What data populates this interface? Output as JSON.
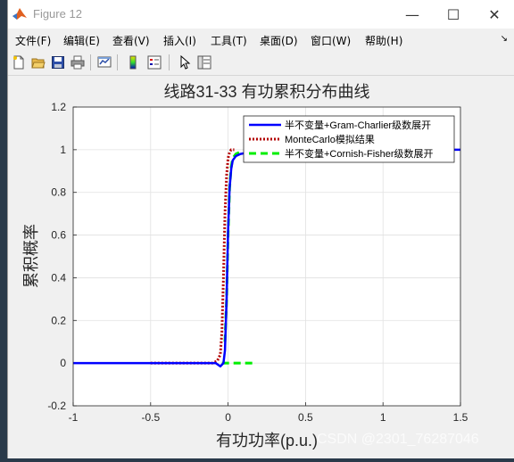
{
  "window": {
    "title": "Figure 12",
    "minimize": "—",
    "maximize": "☐",
    "close": "✕"
  },
  "menu": {
    "items": [
      "文件(F)",
      "编辑(E)",
      "查看(V)",
      "插入(I)",
      "工具(T)",
      "桌面(D)",
      "窗口(W)",
      "帮助(H)"
    ],
    "dock": "↘"
  },
  "toolbar": {
    "icons": [
      "new-figure-icon",
      "open-file-icon",
      "save-icon",
      "print-icon",
      "link-plot-icon",
      "colorbar-icon",
      "legend-icon",
      "edit-plot-arrow-icon",
      "property-inspector-icon"
    ]
  },
  "watermark": "CSDN @2301_76287046",
  "colors": {
    "gram_charlier": "#0000ff",
    "monte_carlo": "#b30000",
    "cornish_fisher": "#00ee00"
  },
  "chart_data": {
    "type": "line",
    "title": "线路31-33 有功累积分布曲线",
    "xlabel": "有功功率(p.u.)",
    "ylabel": "累积概率",
    "xlim": [
      -1,
      1.5
    ],
    "ylim": [
      -0.2,
      1.2
    ],
    "xticks": [
      "-1",
      "-0.5",
      "0",
      "0.5",
      "1",
      "1.5"
    ],
    "yticks": [
      "-0.2",
      "0",
      "0.2",
      "0.4",
      "0.6",
      "0.8",
      "1",
      "1.2"
    ],
    "grid": true,
    "legend_position": "top-right",
    "series": [
      {
        "name": "半不变量+Gram-Charlier级数展开",
        "style": "solid",
        "x": [
          -1,
          -0.2,
          -0.08,
          -0.05,
          -0.03,
          -0.02,
          -0.01,
          0,
          0.01,
          0.02,
          0.03,
          0.05,
          0.08,
          0.15,
          0.3,
          1.5
        ],
        "y": [
          0,
          0,
          0,
          -0.015,
          0.0,
          0.06,
          0.3,
          0.62,
          0.82,
          0.91,
          0.95,
          0.97,
          0.98,
          0.99,
          1.0,
          1.0
        ]
      },
      {
        "name": "MonteCarlo模拟结果",
        "style": "dotted",
        "x": [
          -0.5,
          -0.1,
          -0.07,
          -0.05,
          -0.04,
          -0.03,
          -0.02,
          -0.01,
          0,
          0.01,
          0.02,
          0.04
        ],
        "y": [
          0,
          0,
          0.01,
          0.04,
          0.15,
          0.4,
          0.7,
          0.88,
          0.96,
          0.99,
          1.0,
          1.0
        ]
      },
      {
        "name": "半不变量+Cornish-Fisher级数展开",
        "style": "dashed",
        "x": [
          -0.04,
          0.18,
          null,
          -0.02,
          -0.01,
          0,
          0.01,
          0.02,
          0.03,
          0.05,
          0.08
        ],
        "y": [
          0,
          0,
          null,
          0.1,
          0.3,
          0.6,
          0.82,
          0.92,
          0.96,
          0.98,
          0.99
        ]
      }
    ]
  }
}
